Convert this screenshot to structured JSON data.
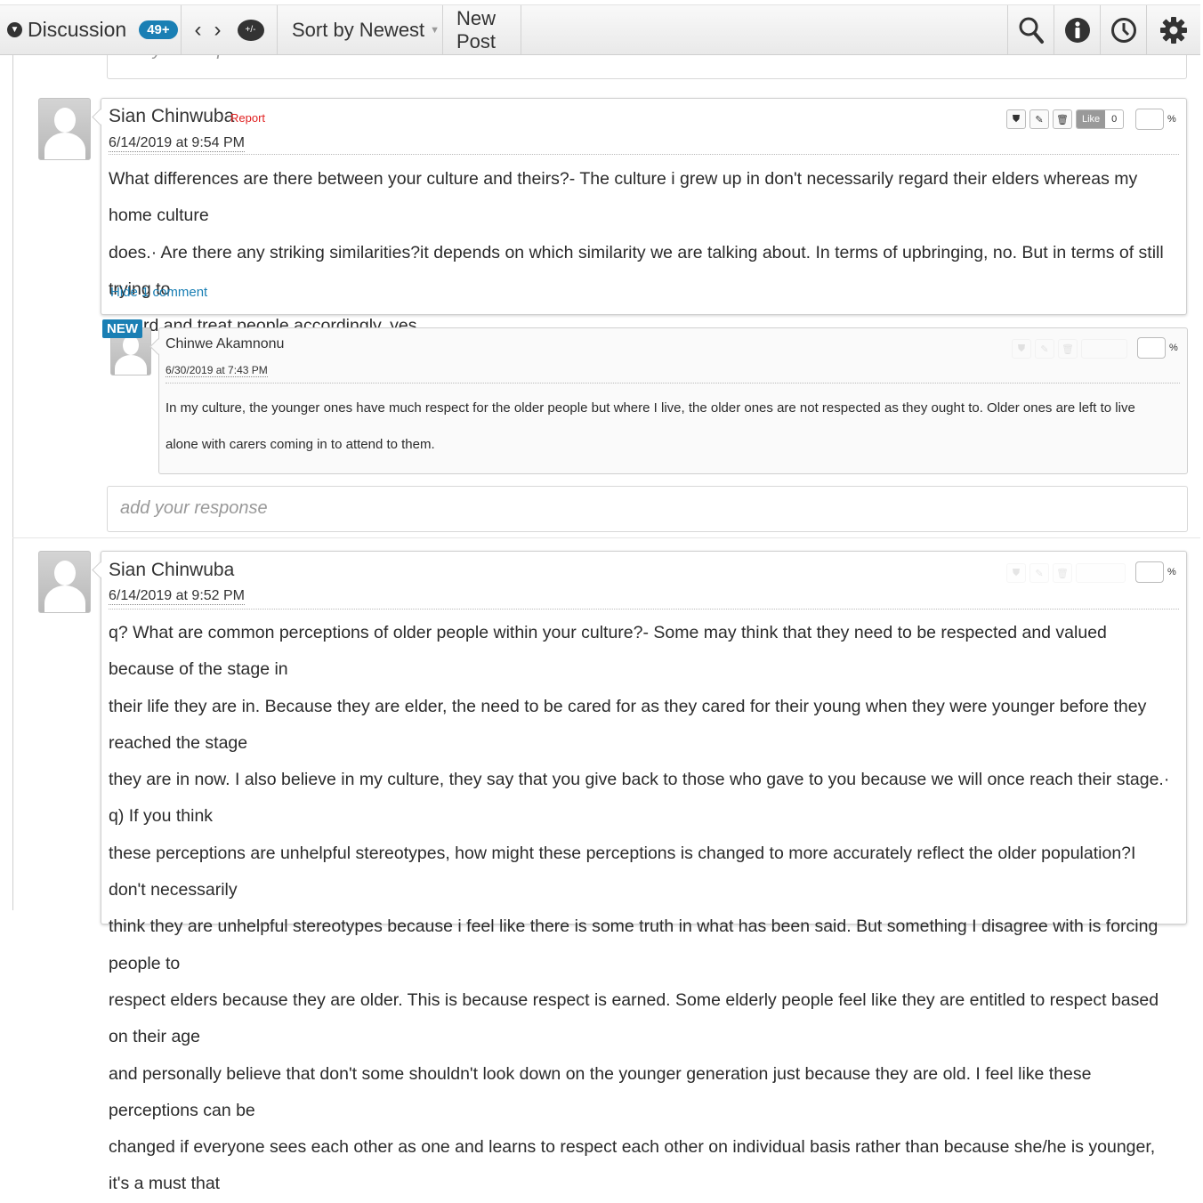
{
  "toolbar": {
    "discussion_label": "Discussion",
    "discussion_count": "49+",
    "sort_label": "Sort by Newest",
    "new_post_label": "New Post",
    "chat_icon_text": "+/-"
  },
  "prev_response_placeholder": "add your response",
  "post1": {
    "author": "Sian Chinwuba",
    "report_label": "Report",
    "date": "6/14/2019 at 9:54 PM",
    "like_label": "Like",
    "like_count": "0",
    "percent": "%",
    "lines": [
      "What differences are there between your culture and theirs?- The culture i grew up in don't necessarily regard their elders whereas my home culture",
      "does.·        Are there any striking similarities?it depends on which similarity we are talking about. In terms of upbringing, no. But in terms of still trying to",
      "regard and treat people accordingly, yes."
    ],
    "hide_comments": "Hide 1 comment"
  },
  "comment1": {
    "new_badge": "NEW",
    "author": "Chinwe Akamnonu",
    "date": "6/30/2019 at 7:43 PM",
    "percent": "%",
    "lines": [
      "In my culture, the younger ones have much respect for the older people but where I live, the older ones are not respected as they ought to. Older ones are left to live",
      "alone with carers coming in to attend to them."
    ]
  },
  "response_placeholder": "add your response",
  "post2": {
    "author": "Sian Chinwuba",
    "date": "6/14/2019 at 9:52 PM",
    "percent": "%",
    "lines": [
      "q? What are common perceptions of older people within your culture?- Some may think that they need to be respected and valued because of the stage in",
      "their life they are in. Because they are elder, the need to be cared for as they cared for their young when they were younger before they reached the stage",
      "they are in now. I also believe in my culture, they say that you give back to those who gave to you because we will once reach their stage.·  q)  If you think",
      "these perceptions are unhelpful stereotypes, how might these perceptions is changed to more accurately reflect   the older population?I don't necessarily",
      "think they are unhelpful stereotypes because i feel like there is some truth in what has been said. But something I disagree with is forcing people to",
      "respect elders because they are older. This is because respect is earned. Some elderly people feel like they are entitled to respect based on their age",
      "and  personally believe that don't some shouldn't look down on the younger generation just because they are old. I feel like these perceptions can be",
      "changed if everyone sees each other as one and learns to respect each other on individual basis rather than because she/he is younger, it's a must that"
    ]
  },
  "icons": [
    "search-icon",
    "info-icon",
    "clock-icon",
    "gear-icon",
    "chevron-left-icon",
    "chevron-right-icon",
    "chat-icon",
    "moderate-icon",
    "edit-icon",
    "trash-icon"
  ]
}
